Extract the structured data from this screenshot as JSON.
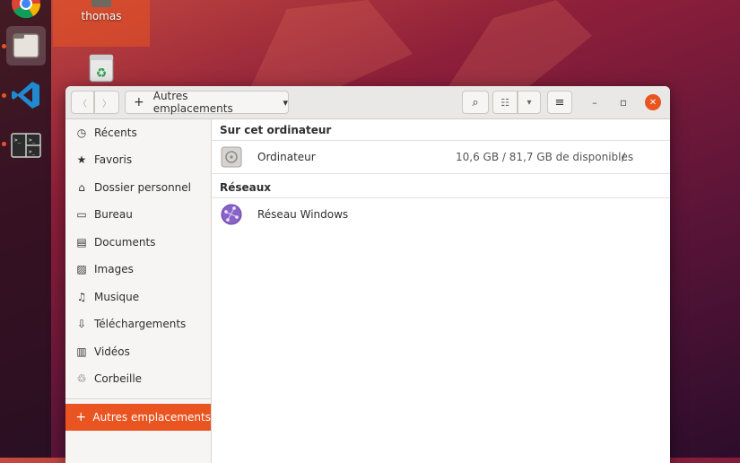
{
  "desktop": {
    "home_label": "thomas"
  },
  "dock": {
    "items": [
      {
        "name": "chrome-icon"
      },
      {
        "name": "files-icon"
      },
      {
        "name": "vscode-icon"
      },
      {
        "name": "terminal-icon"
      }
    ]
  },
  "window": {
    "location_label": "Autres emplacements",
    "nav_back": "〈",
    "nav_forward": "〉",
    "add_symbol": "+",
    "dropdown_symbol": "▾",
    "search_symbol": "⌕",
    "list_view_symbol": "☷",
    "menu_symbol": "≡",
    "minimize_symbol": "–",
    "maximize_symbol": "▫",
    "close_symbol": "✕"
  },
  "sidebar": {
    "items": [
      {
        "label": "Récents",
        "icon": "◷"
      },
      {
        "label": "Favoris",
        "icon": "★"
      },
      {
        "label": "Dossier personnel",
        "icon": "⌂"
      },
      {
        "label": "Bureau",
        "icon": "▭"
      },
      {
        "label": "Documents",
        "icon": "▤"
      },
      {
        "label": "Images",
        "icon": "▨"
      },
      {
        "label": "Musique",
        "icon": "♫"
      },
      {
        "label": "Téléchargements",
        "icon": "⇩"
      },
      {
        "label": "Vidéos",
        "icon": "▥"
      },
      {
        "label": "Corbeille",
        "icon": "♲"
      }
    ],
    "other_locations": {
      "label": "Autres emplacements",
      "icon": "+"
    }
  },
  "main": {
    "section_computer": "Sur cet ordinateur",
    "computer_row": {
      "name": "Ordinateur",
      "info": "10,6 GB / 81,7 GB de disponibles",
      "path": "/"
    },
    "section_networks": "Réseaux",
    "network_row": {
      "name": "Réseau Windows"
    }
  },
  "colors": {
    "accent": "#e95420",
    "sidebar_bg": "#f6f5f4",
    "headerbar_bg": "#e9e8e6"
  }
}
